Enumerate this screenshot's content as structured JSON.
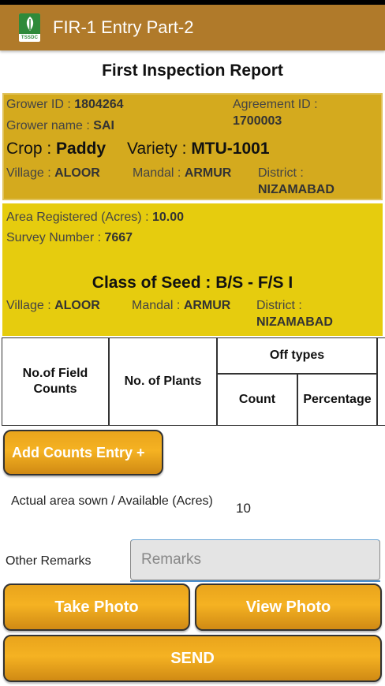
{
  "app": {
    "title": "FIR-1 Entry Part-2",
    "logo_text": "TSSDC"
  },
  "report_title": "First Inspection Report",
  "grower": {
    "grower_id_label": "Grower ID : ",
    "grower_id": "1804264",
    "agreement_id_label": "Agreement ID :",
    "agreement_id": "1700003",
    "grower_name_label": "Grower name : ",
    "grower_name": "SAI",
    "crop_label": "Crop : ",
    "crop": "Paddy",
    "variety_label": "Variety : ",
    "variety": "MTU-1001",
    "village_label": "Village : ",
    "village": "ALOOR",
    "mandal_label": "Mandal : ",
    "mandal": "ARMUR",
    "district_label": "District :",
    "district": "NIZAMABAD"
  },
  "field": {
    "area_label": "Area Registered (Acres) : ",
    "area": "10.00",
    "survey_label": "Survey Number : ",
    "survey": "7667",
    "class_label": "Class of Seed : ",
    "class": "B/S - F/S I",
    "village_label": "Village : ",
    "village": "ALOOR",
    "mandal_label": "Mandal : ",
    "mandal": "ARMUR",
    "district_label": "District :",
    "district": "NIZAMABAD"
  },
  "table": {
    "col_field_counts": "No.of Field Counts",
    "col_plants": "No. of Plants",
    "col_offtypes": "Off types",
    "col_count": "Count",
    "col_percentage": "Percentage"
  },
  "add_counts_label": "Add Counts Entry +",
  "actual_area": {
    "label": "Actual area sown / Available (Acres)",
    "value": "10"
  },
  "remarks": {
    "label": "Other Remarks",
    "placeholder": "Remarks"
  },
  "buttons": {
    "take_photo": "Take Photo",
    "view_photo": "View Photo",
    "send": "SEND"
  },
  "colors": {
    "appbar": "#b07a2a",
    "grower_box": "#d4aa1e",
    "field_box": "#e6cc0e",
    "button": "#f5b222"
  }
}
